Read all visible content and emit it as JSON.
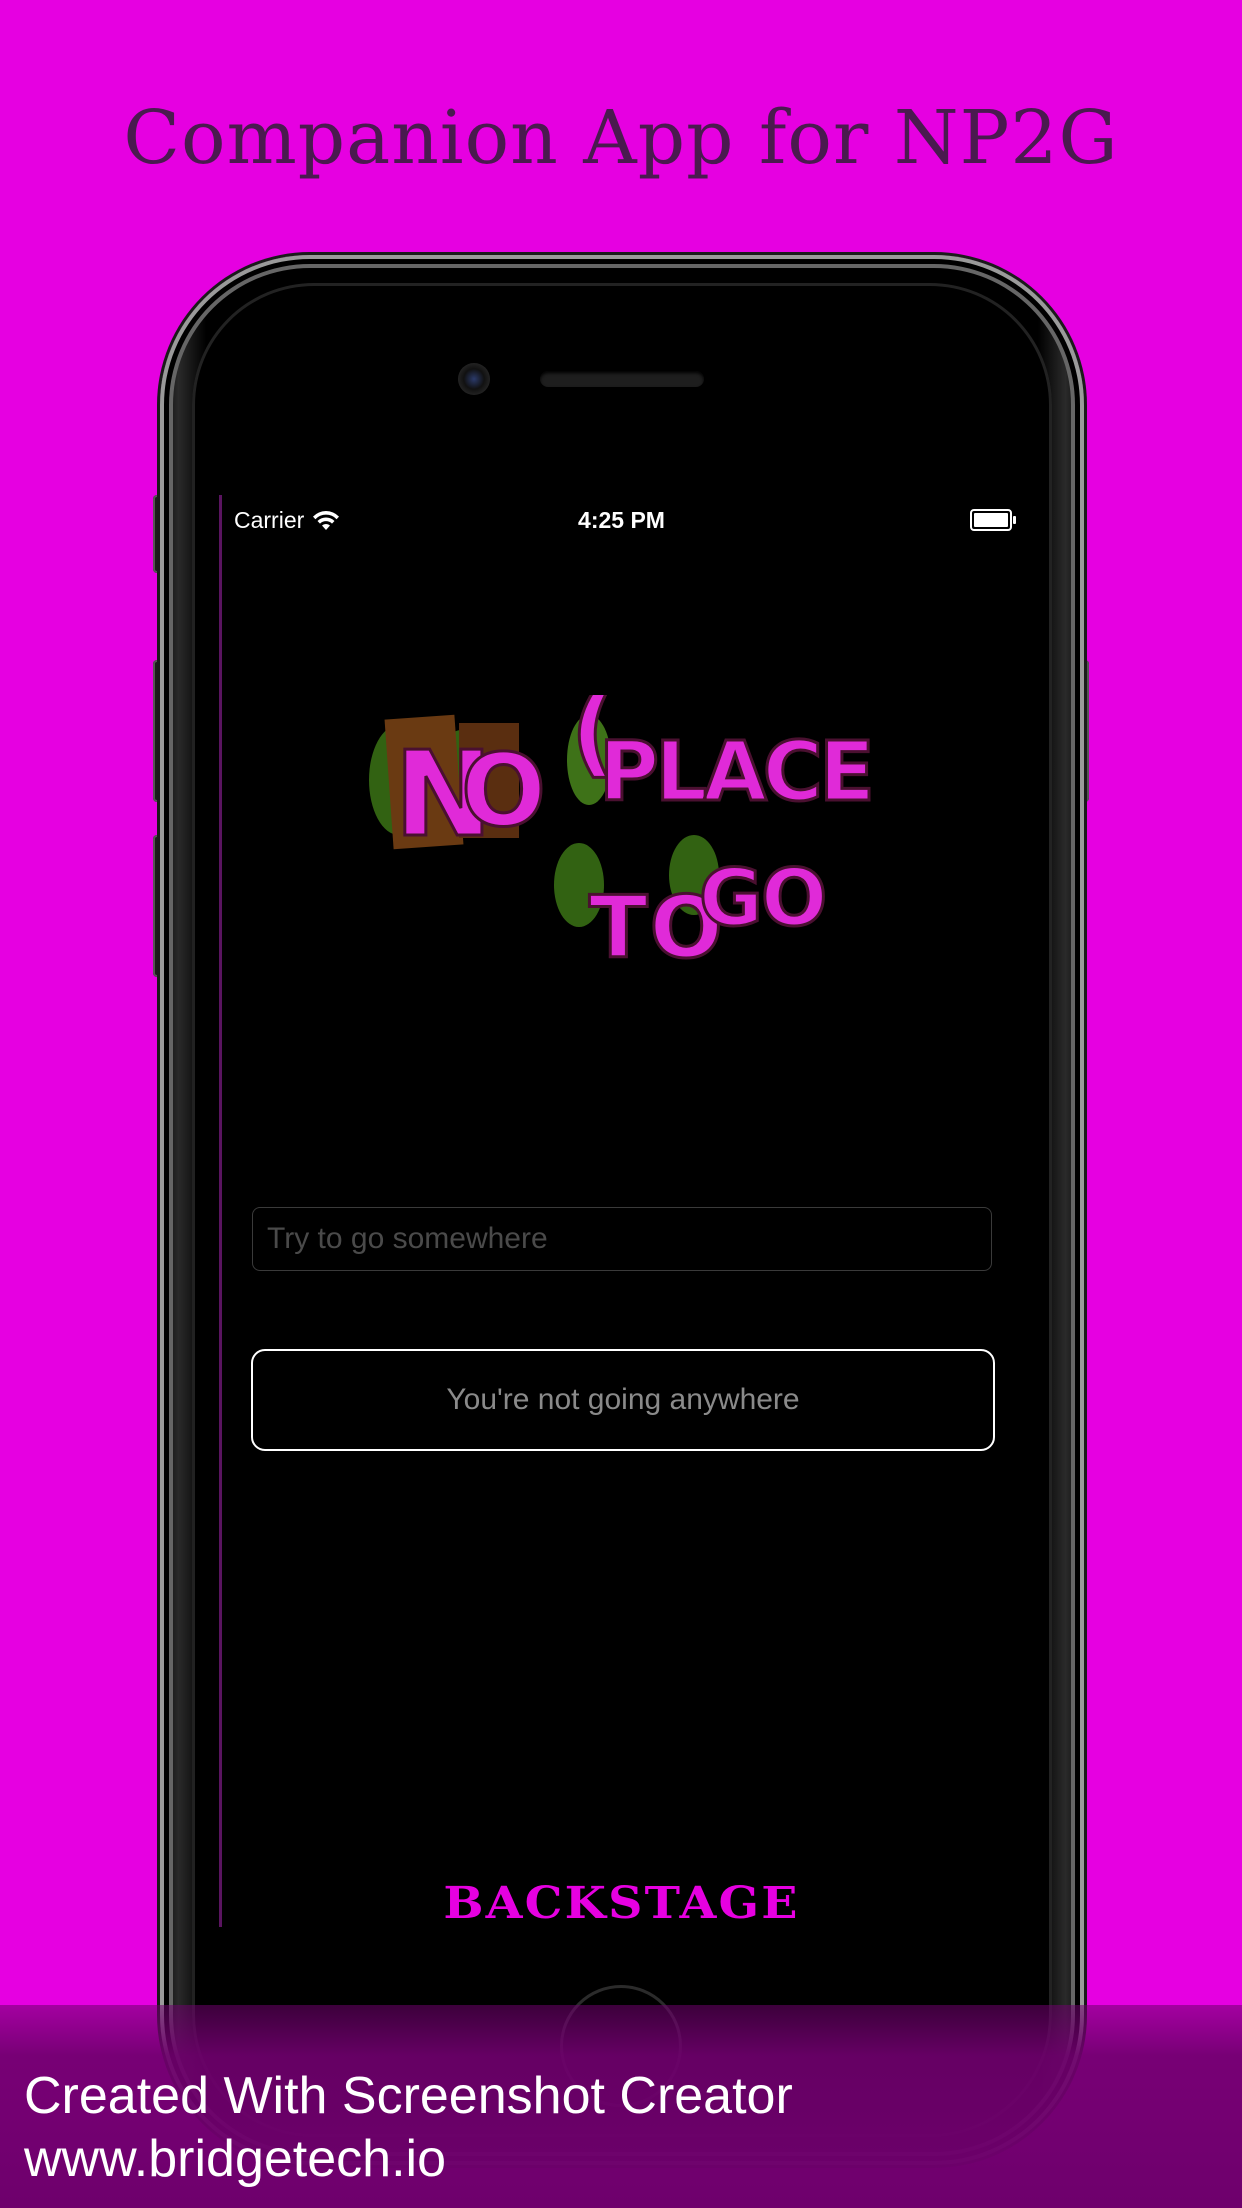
{
  "headline": "Companion App for NP2G",
  "status_bar": {
    "carrier": "Carrier",
    "time": "4:25 PM"
  },
  "logo": {
    "line1": "NO PLACE",
    "line2": "TO GO"
  },
  "search": {
    "placeholder": "Try to go somewhere",
    "value": ""
  },
  "go_button": {
    "label": "You're not going anywhere"
  },
  "backstage_label": "BACKSTAGE",
  "footer": {
    "line1": "Created With Screenshot Creator",
    "line2": "www.bridgetech.io"
  },
  "colors": {
    "background": "#e600e1",
    "logo_pink": "#e02ad8",
    "logo_green": "#6ab02c",
    "backstage": "#e600e1",
    "footer": "#6e006c"
  }
}
